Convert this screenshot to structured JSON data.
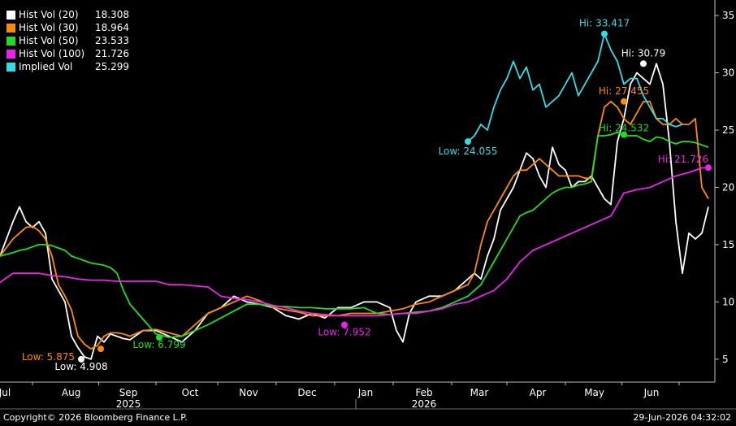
{
  "chart_data": {
    "type": "line",
    "ylim": [
      3,
      36
    ],
    "yticks": [
      5,
      10,
      15,
      20,
      25,
      30,
      35
    ],
    "xlim": [
      0,
      100
    ],
    "month_labels": [
      {
        "label": "Jul",
        "x": 5
      },
      {
        "label": "Aug",
        "x": 15.2
      },
      {
        "label": "Sep",
        "x": 24
      },
      {
        "label": "Oct",
        "x": 33.5
      },
      {
        "label": "Nov",
        "x": 42.5
      },
      {
        "label": "Dec",
        "x": 51.5
      },
      {
        "label": "Jan",
        "x": 60.5
      },
      {
        "label": "Feb",
        "x": 69.5
      },
      {
        "label": "Mar",
        "x": 78
      },
      {
        "label": "Apr",
        "x": 87
      },
      {
        "label": "May",
        "x": 95.7
      },
      {
        "label": "Jun",
        "x": 104.5
      }
    ],
    "year_labels": [
      {
        "label": "2025",
        "x": 24
      },
      {
        "label": "2026",
        "x": 69.5
      }
    ],
    "series": [
      {
        "name": "Hist Vol (20)",
        "value": "18.308",
        "color": "#ffffff",
        "x": [
          0,
          2,
          3,
          4,
          5,
          6,
          7,
          8,
          9,
          10,
          11,
          12,
          13,
          14,
          15,
          16,
          17,
          18,
          19,
          20,
          22,
          24,
          26,
          28,
          30,
          32,
          34,
          36,
          38,
          40,
          42,
          44,
          46,
          48,
          50,
          52,
          54,
          56,
          58,
          60,
          61,
          62,
          63,
          64,
          66,
          68,
          70,
          72,
          73,
          74,
          75,
          76,
          77,
          78,
          79,
          80,
          81,
          82,
          83,
          84,
          85,
          86,
          87,
          88,
          89,
          90,
          91,
          92,
          93,
          94,
          95,
          96,
          97,
          98,
          99,
          100,
          101,
          102,
          103,
          104,
          105,
          106,
          107,
          108,
          109
        ],
        "y": [
          14,
          17,
          18.3,
          17,
          16.5,
          17,
          16,
          12,
          11,
          10,
          7,
          6,
          5.2,
          5,
          7,
          6.5,
          7.2,
          7,
          6.8,
          6.7,
          7.5,
          7.5,
          7,
          6.5,
          7.5,
          9,
          9.5,
          10.5,
          10,
          9.8,
          9.5,
          8.8,
          8.5,
          9,
          8.6,
          9.5,
          9.5,
          10,
          10,
          9.5,
          7.5,
          6.5,
          9,
          10,
          10.5,
          10.5,
          11,
          12,
          12.5,
          12,
          14,
          15.5,
          18,
          19,
          20,
          21.5,
          23,
          22.5,
          21,
          20,
          23.5,
          22,
          21.5,
          20,
          20.5,
          20.5,
          21,
          20,
          19,
          18.5,
          24,
          26,
          29,
          30,
          29.5,
          29,
          30.8,
          29,
          24,
          17,
          12.5,
          16,
          15.5,
          16,
          18.3
        ]
      },
      {
        "name": "Hist Vol (30)",
        "value": "18.964",
        "color": "#ff8c00",
        "x": [
          0,
          2,
          3,
          4,
          5,
          6,
          7,
          8,
          9,
          10,
          11,
          12,
          13,
          14,
          15,
          16,
          17,
          18,
          19,
          20,
          22,
          24,
          26,
          28,
          30,
          32,
          34,
          36,
          38,
          40,
          42,
          44,
          46,
          48,
          50,
          52,
          54,
          56,
          58,
          60,
          62,
          64,
          66,
          68,
          70,
          72,
          73,
          74,
          75,
          76,
          77,
          78,
          79,
          80,
          81,
          82,
          83,
          84,
          85,
          86,
          87,
          88,
          89,
          90,
          91,
          92,
          93,
          94,
          95,
          96,
          97,
          98,
          99,
          100,
          101,
          102,
          103,
          104,
          105,
          106,
          107,
          108,
          109
        ],
        "y": [
          14,
          15.5,
          16,
          16.5,
          16.6,
          16.2,
          15.5,
          14,
          11.5,
          10.5,
          9.3,
          7,
          6.3,
          5.9,
          6.2,
          7,
          7.3,
          7.3,
          7.2,
          7,
          7.5,
          7.6,
          7.3,
          7,
          8,
          9,
          9.5,
          10,
          10.5,
          10.1,
          9.5,
          9.3,
          9.1,
          8.8,
          8.8,
          8.8,
          9,
          9,
          9,
          9.2,
          9.4,
          9.8,
          10,
          10.5,
          11,
          11.5,
          12.5,
          15,
          17,
          18,
          19,
          20,
          21,
          21.5,
          21.5,
          22,
          22.5,
          22,
          21.5,
          21,
          21,
          21,
          21,
          20.8,
          20.8,
          24.5,
          27,
          27.5,
          27,
          26,
          25.5,
          26.5,
          27.5,
          27.5,
          26,
          25.5,
          25.5,
          26,
          25.5,
          25.5,
          26,
          20,
          19
        ]
      },
      {
        "name": "Hist Vol (50)",
        "value": "23.533",
        "color": "#22dd22",
        "x": [
          0,
          2,
          3,
          4,
          5,
          6,
          7,
          8,
          9,
          10,
          11,
          12,
          13,
          14,
          15,
          16,
          17,
          18,
          19,
          20,
          22,
          24,
          26,
          28,
          30,
          32,
          34,
          36,
          38,
          40,
          42,
          44,
          46,
          48,
          50,
          52,
          54,
          56,
          58,
          60,
          62,
          64,
          66,
          68,
          70,
          72,
          74,
          75,
          76,
          77,
          78,
          79,
          80,
          81,
          82,
          83,
          84,
          85,
          86,
          87,
          88,
          89,
          90,
          91,
          92,
          93,
          94,
          95,
          96,
          97,
          98,
          99,
          100,
          101,
          102,
          103,
          104,
          105,
          106,
          107,
          108,
          109
        ],
        "y": [
          14,
          14.3,
          14.5,
          14.6,
          14.8,
          15,
          15,
          14.9,
          14.7,
          14.5,
          14,
          13.8,
          13.6,
          13.4,
          13.3,
          13.2,
          13,
          12.5,
          11,
          9.8,
          8.5,
          7.2,
          6.9,
          7,
          7.5,
          8,
          8.6,
          9.2,
          9.8,
          9.8,
          9.6,
          9.6,
          9.5,
          9.5,
          9.4,
          9.4,
          9.4,
          9.5,
          9,
          8.9,
          9,
          9.1,
          9.2,
          9.5,
          10,
          10.5,
          11.5,
          12.5,
          13.5,
          14.5,
          15.5,
          16.5,
          17.5,
          17.8,
          18,
          18.5,
          19,
          19.5,
          19.8,
          20,
          20,
          20.2,
          20.3,
          20.5,
          24.5,
          24.5,
          24.6,
          24.8,
          24.5,
          24.5,
          24.5,
          24.2,
          24,
          24.4,
          24.3,
          24,
          23.8,
          24,
          24,
          23.9,
          23.7,
          23.5
        ]
      },
      {
        "name": "Hist Vol (100)",
        "value": "21.726",
        "color": "#ee22ee",
        "x": [
          0,
          2,
          4,
          6,
          8,
          10,
          12,
          14,
          16,
          18,
          20,
          22,
          24,
          26,
          28,
          30,
          32,
          34,
          36,
          38,
          40,
          42,
          44,
          46,
          48,
          50,
          52,
          54,
          56,
          58,
          60,
          62,
          64,
          66,
          68,
          70,
          72,
          74,
          76,
          78,
          80,
          82,
          84,
          86,
          88,
          90,
          92,
          94,
          96,
          98,
          100,
          102,
          104,
          106,
          108,
          109
        ],
        "y": [
          11.7,
          12.5,
          12.5,
          12.5,
          12.3,
          12.2,
          12,
          11.9,
          11.9,
          11.8,
          11.8,
          11.8,
          11.8,
          11.5,
          11.5,
          11.4,
          11.3,
          10.5,
          10.3,
          10.2,
          10,
          9.7,
          9.5,
          9.2,
          9,
          8.9,
          8.8,
          8.8,
          8.8,
          8.8,
          8.9,
          9,
          9,
          9.2,
          9.4,
          9.8,
          10,
          10.5,
          11,
          12,
          13.5,
          14.5,
          15,
          15.5,
          16,
          16.5,
          17,
          17.5,
          19.5,
          19.8,
          20,
          20.5,
          21,
          21.3,
          21.7,
          21.726
        ]
      },
      {
        "name": "Implied Vol",
        "value": "25.299",
        "color": "#33dde8",
        "x": [
          72,
          73,
          74,
          75,
          76,
          77,
          78,
          79,
          80,
          81,
          82,
          83,
          84,
          85,
          86,
          87,
          88,
          89,
          90,
          91,
          92,
          93,
          94,
          95,
          96,
          97,
          98,
          99,
          100,
          101,
          102,
          103,
          104,
          105
        ],
        "y": [
          24,
          24.5,
          25.5,
          25,
          27,
          28.5,
          29.5,
          31,
          29.5,
          30.5,
          28.5,
          29,
          27,
          27.5,
          28,
          29,
          30,
          28,
          29,
          30,
          31,
          33.4,
          32,
          31,
          29,
          29.5,
          29.5,
          28,
          27,
          26,
          26,
          25.5,
          25.3,
          25.5
        ]
      }
    ],
    "annotations": [
      {
        "text": "Low: 4.908",
        "x": 12.5,
        "y": 5,
        "color": "#ffffff",
        "anchor": "middle",
        "dx": 0,
        "dy": 13
      },
      {
        "text": "Low: 5.875",
        "x": 15.5,
        "y": 5.9,
        "color": "#ff8c00",
        "anchor": "end",
        "dx": -32,
        "dy": 14
      },
      {
        "text": "Low: 6.799",
        "x": 24.5,
        "y": 6.9,
        "color": "#22dd22",
        "anchor": "middle",
        "dx": 0,
        "dy": 13
      },
      {
        "text": "Low: 7.952",
        "x": 53,
        "y": 8,
        "color": "#ee22ee",
        "anchor": "middle",
        "dx": 0,
        "dy": 13
      },
      {
        "text": "Low: 24.055",
        "x": 72,
        "y": 24,
        "color": "#33dde8",
        "anchor": "middle",
        "dx": 0,
        "dy": 16
      },
      {
        "text": "Hi: 33.417",
        "x": 93,
        "y": 33.4,
        "color": "#33dde8",
        "anchor": "middle",
        "dx": 0,
        "dy": -9
      },
      {
        "text": "Hi: 30.79",
        "x": 99,
        "y": 30.8,
        "color": "#ffffff",
        "anchor": "middle",
        "dx": 0,
        "dy": -9
      },
      {
        "text": "Hi: 27.455",
        "x": 96,
        "y": 27.5,
        "color": "#ff8c00",
        "anchor": "middle",
        "dx": 0,
        "dy": -9
      },
      {
        "text": "Hi: 24.532",
        "x": 96,
        "y": 24.6,
        "color": "#22dd22",
        "anchor": "middle",
        "dx": 0,
        "dy": -4
      },
      {
        "text": "Hi: 21.726",
        "x": 109,
        "y": 21.726,
        "color": "#ee22ee",
        "anchor": "end",
        "dx": 0,
        "dy": -6
      }
    ]
  },
  "footer": {
    "copyright": "Copyright© 2026 Bloomberg Finance L.P.",
    "timestamp": "29-Jun-2026 04:32:02"
  }
}
